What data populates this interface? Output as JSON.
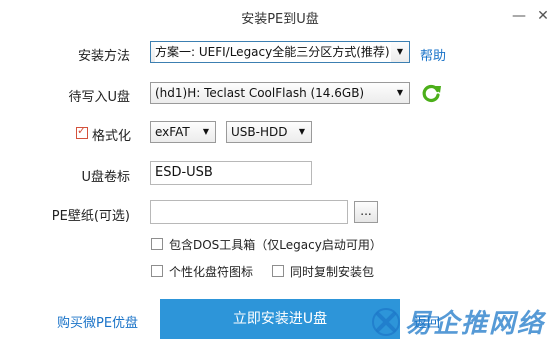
{
  "window": {
    "title": "安装PE到U盘",
    "minimize_symbol": "—",
    "close_symbol": "✕"
  },
  "install_method": {
    "label": "安装方法",
    "selected": "方案一: UEFI/Legacy全能三分区方式(推荐)",
    "help_link": "帮助"
  },
  "target_drive": {
    "label": "待写入U盘",
    "selected": "(hd1)H: Teclast CoolFlash (14.6GB)"
  },
  "format": {
    "label": "格式化",
    "checked": true,
    "filesystem": "exFAT",
    "mode": "USB-HDD"
  },
  "volume_label": {
    "label": "U盘卷标",
    "value": "ESD-USB"
  },
  "wallpaper": {
    "label": "PE壁纸(可选)",
    "value": "",
    "browse_label": "..."
  },
  "options": [
    {
      "label": "包含DOS工具箱（仅Legacy启动可用）",
      "checked": false
    },
    {
      "label": "个性化盘符图标",
      "checked": false
    },
    {
      "label": "同时复制安装包",
      "checked": false
    }
  ],
  "footer": {
    "buy_link": "购买微PE优盘",
    "install_button": "立即安装进U盘",
    "back_link": "返回",
    "watermark": "易企推网络"
  },
  "colors": {
    "accent": "#2d95d9",
    "link": "#1a73c8",
    "refresh": "#4caf1a",
    "check": "#d4523c"
  }
}
